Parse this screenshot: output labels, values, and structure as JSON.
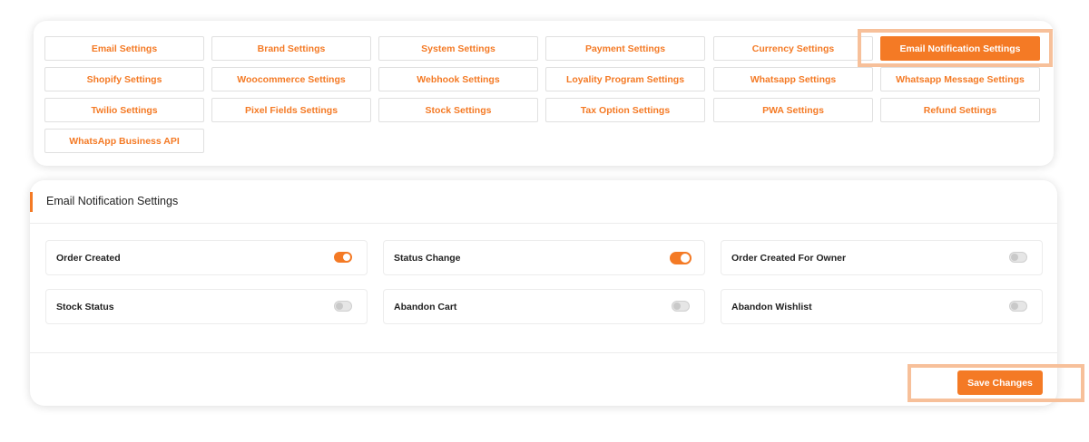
{
  "settings_tabs": [
    {
      "label": "Email Settings",
      "active": false
    },
    {
      "label": "Brand Settings",
      "active": false
    },
    {
      "label": "System Settings",
      "active": false
    },
    {
      "label": "Payment Settings",
      "active": false
    },
    {
      "label": "Currency Settings",
      "active": false
    },
    {
      "label": "Email Notification Settings",
      "active": true
    },
    {
      "label": "Shopify Settings",
      "active": false
    },
    {
      "label": "Woocommerce Settings",
      "active": false
    },
    {
      "label": "Webhook Settings",
      "active": false
    },
    {
      "label": "Loyality Program Settings",
      "active": false
    },
    {
      "label": "Whatsapp Settings",
      "active": false
    },
    {
      "label": "Whatsapp Message Settings",
      "active": false
    },
    {
      "label": "Twilio Settings",
      "active": false
    },
    {
      "label": "Pixel Fields Settings",
      "active": false
    },
    {
      "label": "Stock Settings",
      "active": false
    },
    {
      "label": "Tax Option Settings",
      "active": false
    },
    {
      "label": "PWA Settings",
      "active": false
    },
    {
      "label": "Refund Settings",
      "active": false
    },
    {
      "label": "WhatsApp Business API",
      "active": false
    }
  ],
  "panel": {
    "title": "Email Notification Settings",
    "options": [
      {
        "label": "Order Created",
        "enabled": true
      },
      {
        "label": "Status Change",
        "enabled": true
      },
      {
        "label": "Order Created For Owner",
        "enabled": false
      },
      {
        "label": "Stock Status",
        "enabled": false
      },
      {
        "label": "Abandon Cart",
        "enabled": false
      },
      {
        "label": "Abandon Wishlist",
        "enabled": false
      }
    ],
    "save_label": "Save Changes"
  },
  "colors": {
    "accent": "#f47a25",
    "highlight": "#f7c09a"
  }
}
